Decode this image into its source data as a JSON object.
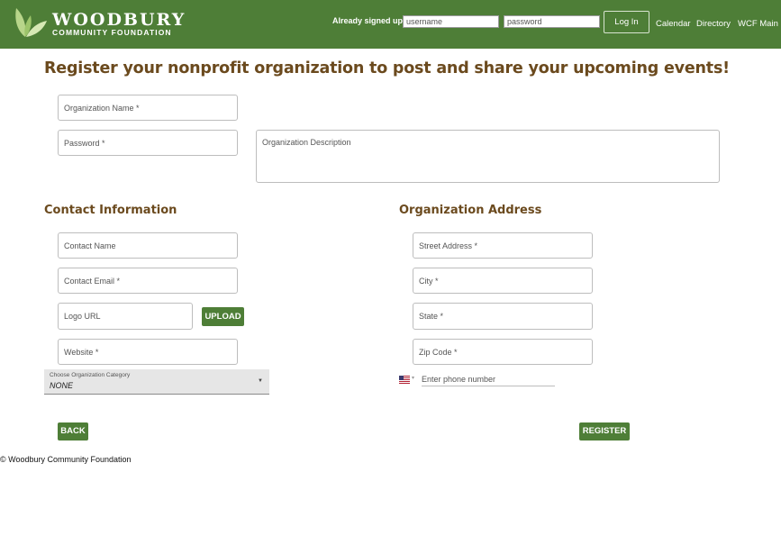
{
  "header": {
    "logo": {
      "name": "WOODBURY",
      "subtitle": "COMMUNITY FOUNDATION"
    },
    "signin_label": "Already signed up?",
    "username_placeholder": "username",
    "password_placeholder": "password",
    "login_label": "Log In",
    "nav": [
      "Calendar",
      "Directory",
      "WCF Main"
    ],
    "color": "#4e7e37"
  },
  "page_title": "Register your nonprofit organization to post and share your upcoming events!",
  "form": {
    "org_name_placeholder": "Organization Name *",
    "password_placeholder": "Password *",
    "description_placeholder": "Organization Description"
  },
  "contact": {
    "title": "Contact Information",
    "name_placeholder": "Contact Name",
    "email_placeholder": "Contact Email *",
    "logo_url_placeholder": "Logo URL",
    "upload_label": "UPLOAD",
    "website_placeholder": "Website *",
    "category": {
      "label": "Choose Organization Category",
      "value": "NONE"
    }
  },
  "address": {
    "title": "Organization Address",
    "street_placeholder": "Street Address *",
    "city_placeholder": "City *",
    "state_placeholder": "State *",
    "zip_placeholder": "Zip Code *",
    "phone_placeholder": "Enter phone number"
  },
  "actions": {
    "back_label": "BACK",
    "register_label": "REGISTER"
  },
  "footer": "© Woodbury Community Foundation",
  "colors": {
    "brand_green": "#4e7e37",
    "heading_brown": "#6b4a1e"
  }
}
